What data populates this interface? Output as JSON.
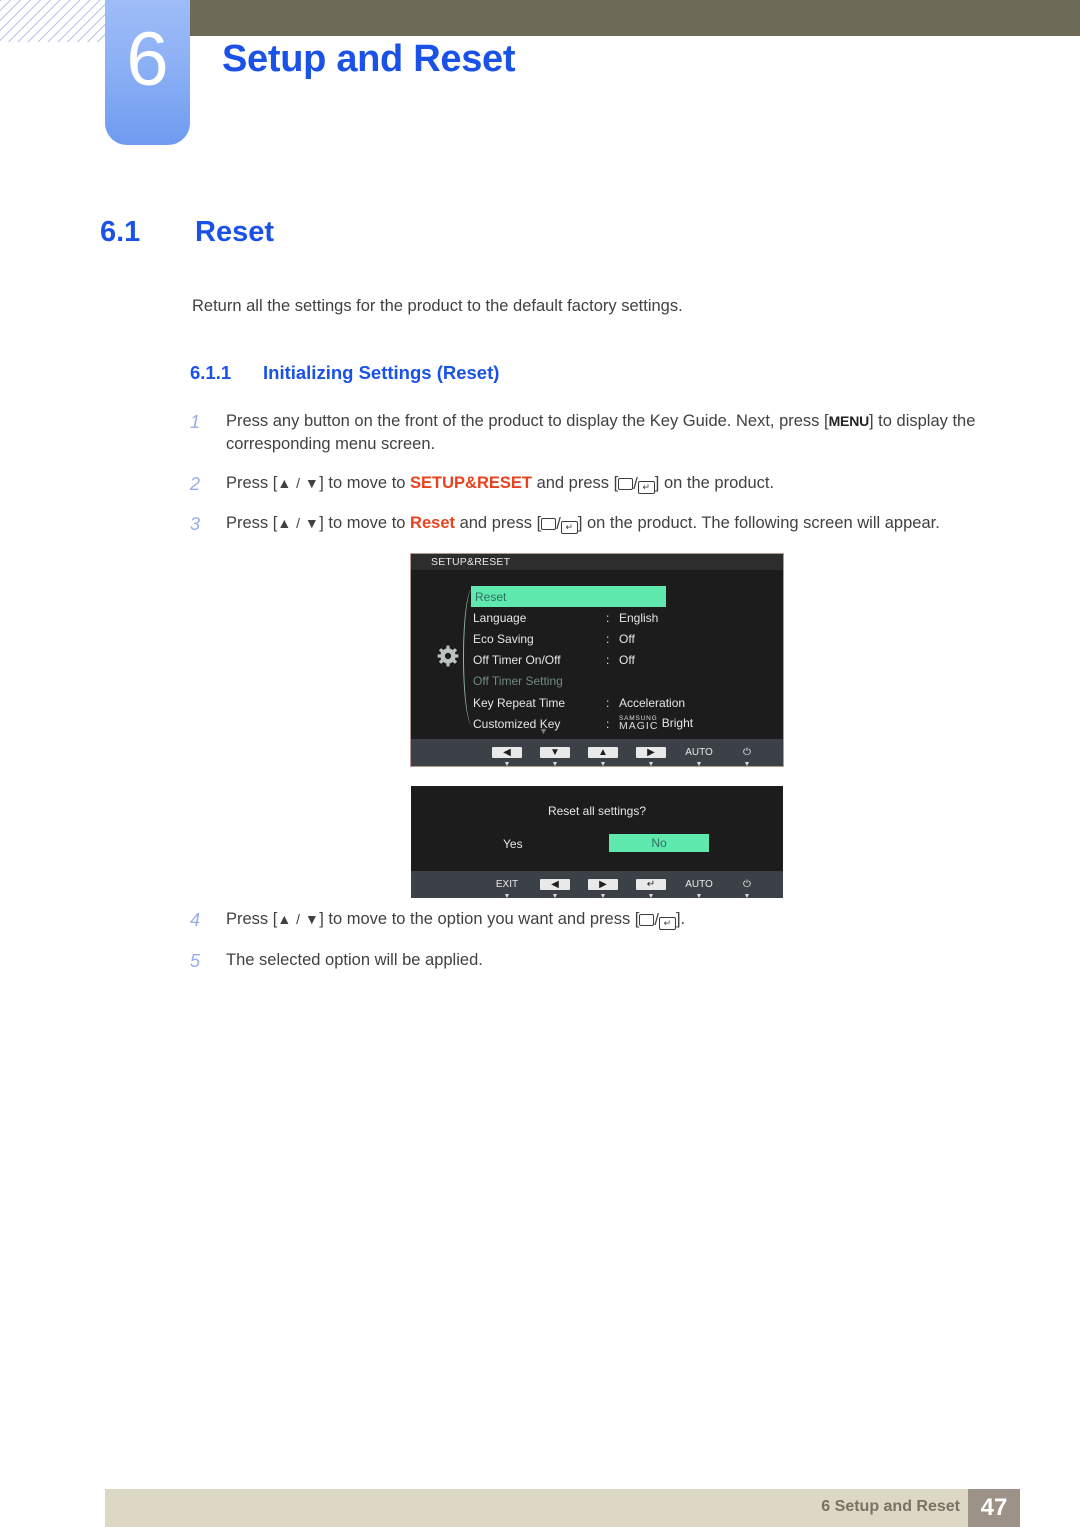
{
  "header": {
    "chapter_number": "6",
    "chapter_title": "Setup and Reset"
  },
  "section": {
    "number": "6.1",
    "title": "Reset",
    "intro": "Return all the settings for the product to the default factory settings."
  },
  "subsection": {
    "number": "6.1.1",
    "title": "Initializing Settings (Reset)"
  },
  "steps": [
    {
      "num": "1",
      "parts": [
        {
          "t": "Press any button on the front of the product to display the Key Guide. Next, press ["
        },
        {
          "t": "MENU",
          "style": "kbd"
        },
        {
          "t": "] to display the corresponding menu screen."
        }
      ]
    },
    {
      "num": "2",
      "parts": [
        {
          "t": "Press ["
        },
        {
          "t": "▲ / ▼",
          "style": "arrows"
        },
        {
          "t": "] to move to "
        },
        {
          "t": "SETUP&RESET",
          "style": "orange"
        },
        {
          "t": " and press ["
        },
        {
          "t": "rect-enter",
          "style": "glyph"
        },
        {
          "t": "] on the product."
        }
      ]
    },
    {
      "num": "3",
      "parts": [
        {
          "t": "Press ["
        },
        {
          "t": "▲ / ▼",
          "style": "arrows"
        },
        {
          "t": "] to move to "
        },
        {
          "t": "Reset",
          "style": "orange"
        },
        {
          "t": " and press ["
        },
        {
          "t": "rect-enter",
          "style": "glyph"
        },
        {
          "t": "] on the product. The following screen will appear."
        }
      ]
    },
    {
      "num": "4",
      "parts": [
        {
          "t": "Press ["
        },
        {
          "t": "▲ / ▼",
          "style": "arrows"
        },
        {
          "t": "] to move to the option you want and press ["
        },
        {
          "t": "rect-enter",
          "style": "glyph"
        },
        {
          "t": "]."
        }
      ]
    },
    {
      "num": "5",
      "parts": [
        {
          "t": "The selected option will be applied."
        }
      ]
    }
  ],
  "osd_menu": {
    "title": "SETUP&RESET",
    "rows": [
      {
        "label": "Reset",
        "colon": "",
        "value": "",
        "state": "highlight"
      },
      {
        "label": "Language",
        "colon": ":",
        "value": "English",
        "state": "normal"
      },
      {
        "label": "Eco Saving",
        "colon": ":",
        "value": "Off",
        "state": "normal"
      },
      {
        "label": "Off Timer On/Off",
        "colon": ":",
        "value": "Off",
        "state": "normal"
      },
      {
        "label": "Off Timer Setting",
        "colon": "",
        "value": "",
        "state": "dim"
      },
      {
        "label": "Key Repeat Time",
        "colon": ":",
        "value": "Acceleration",
        "state": "normal"
      },
      {
        "label": "Customized Key",
        "colon": ":",
        "value": "magic-bright",
        "state": "magic"
      }
    ],
    "magic_small": "SAMSUNG",
    "magic_big": "MAGIC",
    "magic_suffix": "Bright",
    "scroll_indicator": "▼",
    "buttons": [
      {
        "face": "◀",
        "boxed": true,
        "tick": "▼"
      },
      {
        "face": "▼",
        "boxed": true,
        "tick": "▼"
      },
      {
        "face": "▲",
        "boxed": true,
        "tick": "▼"
      },
      {
        "face": "▶",
        "boxed": true,
        "tick": "▼"
      },
      {
        "face": "AUTO",
        "boxed": false,
        "tick": "▼"
      },
      {
        "face": "⏻",
        "boxed": false,
        "tick": "▼"
      }
    ]
  },
  "osd_confirm": {
    "question": "Reset all settings?",
    "option_yes": "Yes",
    "option_no": "No",
    "selected": "No",
    "buttons": [
      {
        "face": "EXIT",
        "boxed": false,
        "tick": "▼"
      },
      {
        "face": "◀",
        "boxed": true,
        "tick": "▼"
      },
      {
        "face": "▶",
        "boxed": true,
        "tick": "▼"
      },
      {
        "face": "↵",
        "boxed": true,
        "tick": "▼"
      },
      {
        "face": "AUTO",
        "boxed": false,
        "tick": "▼"
      },
      {
        "face": "⏻",
        "boxed": false,
        "tick": "▼"
      }
    ]
  },
  "colors": {
    "accent_blue": "#1a52e8",
    "header_olive": "#6d6a55",
    "chapter_blue": "#8cb0f5",
    "highlight_green": "#5fe9ae",
    "keyword_orange": "#e8431e",
    "footer_beige": "#dcd8c4",
    "footer_page_brown": "#9d9287"
  },
  "footer": {
    "text": "6 Setup and Reset",
    "page": "47"
  }
}
